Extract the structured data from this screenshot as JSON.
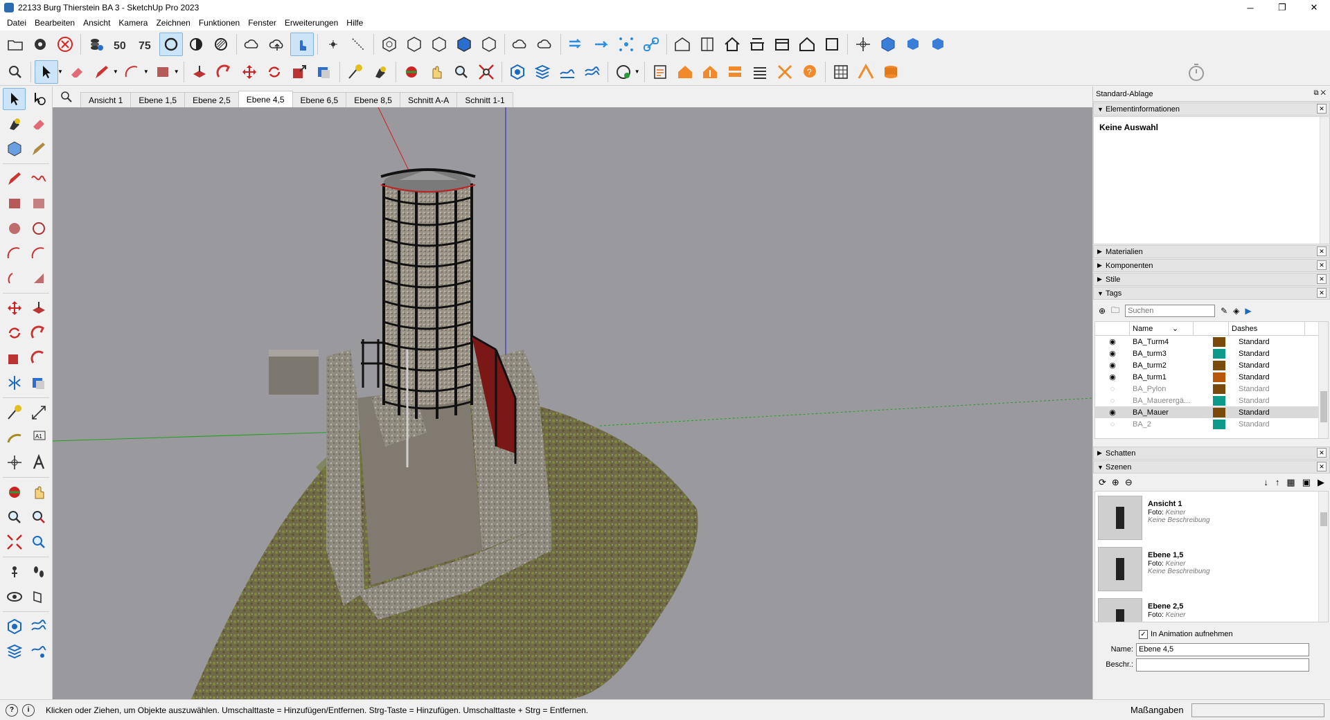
{
  "window": {
    "title": "22133 Burg Thierstein BA 3 - SketchUp Pro 2023"
  },
  "menu": [
    "Datei",
    "Bearbeiten",
    "Ansicht",
    "Kamera",
    "Zeichnen",
    "Funktionen",
    "Fenster",
    "Erweiterungen",
    "Hilfe"
  ],
  "toolbar_icons": {
    "row1": [
      "open-icon",
      "settings-gear-icon",
      "close-circle-icon",
      "layers-icon",
      "fifty-icon",
      "seventy-five-icon",
      "circle-icon",
      "half-circle-icon",
      "hatch-circle-icon",
      "cloud-icon",
      "cloud-upload-icon",
      "touch-icon",
      "point-icon",
      "dotted-line-icon",
      "hex-clock-icon",
      "hex-icon",
      "hex-cloud-icon",
      "hex-cube-icon",
      "hex-arrow-icon",
      "cloud-sync-icon",
      "cloud-loop-icon",
      "arrows-in-icon",
      "arrows-out-icon",
      "network-icon",
      "link-icon",
      "warehouse-icon",
      "book-icon",
      "house-icon",
      "house-parts-icon",
      "house-front-icon",
      "house-outline-icon",
      "square-icon",
      "move-axes-icon",
      "cube-blue-icon",
      "cube-axes-icon",
      "cube-corner-icon"
    ],
    "row2": [
      "zoom-extents-icon",
      "select-icon",
      "eraser-icon",
      "pencil-icon",
      "arc-icon",
      "rectangle-icon",
      "pushpull-icon",
      "followme-icon",
      "move-icon",
      "rotate-icon",
      "scale-icon",
      "offset-icon",
      "tape-icon",
      "paint-icon",
      "orbit-icon",
      "pan-icon",
      "zoom-icon",
      "zoom-window-icon",
      "section-icon",
      "layers-stack-icon",
      "sandbox-icon",
      "sandbox2-icon",
      "geo-icon",
      "checklist-icon",
      "house-orange-icon",
      "house-arrow-icon",
      "house-down-icon",
      "list-icon",
      "tools-icon",
      "help-bubble-icon",
      "grid-icon",
      "roof-icon",
      "database-icon"
    ]
  },
  "scene_tabs": [
    "Ansicht 1",
    "Ebene 1,5",
    "Ebene 2,5",
    "Ebene 4,5",
    "Ebene 6,5",
    "Ebene 8,5",
    "Schnitt A-A",
    "Schnitt 1-1"
  ],
  "active_scene_tab": "Ebene 4,5",
  "tray": {
    "title": "Standard-Ablage",
    "element_info": {
      "header": "Elementinformationen",
      "content": "Keine Auswahl"
    },
    "panels": {
      "materials": "Materialien",
      "components": "Komponenten",
      "styles": "Stile",
      "tags": "Tags",
      "shadows": "Schatten",
      "scenes": "Szenen"
    },
    "tags": {
      "search_placeholder": "Suchen",
      "col_name": "Name",
      "col_dashes": "Dashes",
      "rows": [
        {
          "name": "BA_Turm4",
          "color": "#7a4a0c",
          "dashes": "Standard",
          "visible": true
        },
        {
          "name": "BA_turm3",
          "color": "#0e9a8a",
          "dashes": "Standard",
          "visible": true
        },
        {
          "name": "BA_turm2",
          "color": "#7a4a0c",
          "dashes": "Standard",
          "visible": true
        },
        {
          "name": "BA_turm1",
          "color": "#b8560a",
          "dashes": "Standard",
          "visible": true
        },
        {
          "name": "BA_Pylon",
          "color": "#7a4a0c",
          "dashes": "Standard",
          "visible": false
        },
        {
          "name": "BA_Mauerergä...",
          "color": "#0e9a8a",
          "dashes": "Standard",
          "visible": false
        },
        {
          "name": "BA_Mauer",
          "color": "#7a4a0c",
          "dashes": "Standard",
          "visible": true
        },
        {
          "name": "BA_2",
          "color": "#0e9a8a",
          "dashes": "Standard",
          "visible": false
        }
      ]
    },
    "scenes": {
      "items": [
        {
          "name": "Ansicht 1",
          "foto_label": "Foto:",
          "foto_value": "Keiner",
          "desc": "Keine Beschreibung"
        },
        {
          "name": "Ebene 1,5",
          "foto_label": "Foto:",
          "foto_value": "Keiner",
          "desc": "Keine Beschreibung"
        },
        {
          "name": "Ebene 2,5",
          "foto_label": "Foto:",
          "foto_value": "Keiner",
          "desc": ""
        }
      ],
      "include_animation": "In Animation aufnehmen",
      "name_label": "Name:",
      "name_value": "Ebene 4,5",
      "desc_label": "Beschr.:",
      "desc_value": ""
    }
  },
  "status": {
    "text": "Klicken oder Ziehen, um Objekte auszuwählen. Umschalttaste = Hinzufügen/Entfernen. Strg-Taste = Hinzufügen. Umschalttaste + Strg = Entfernen.",
    "measurements_label": "Maßangaben"
  },
  "colors": {
    "viewport_bg": "#9a9a9e",
    "accent": "#cce4f7"
  }
}
